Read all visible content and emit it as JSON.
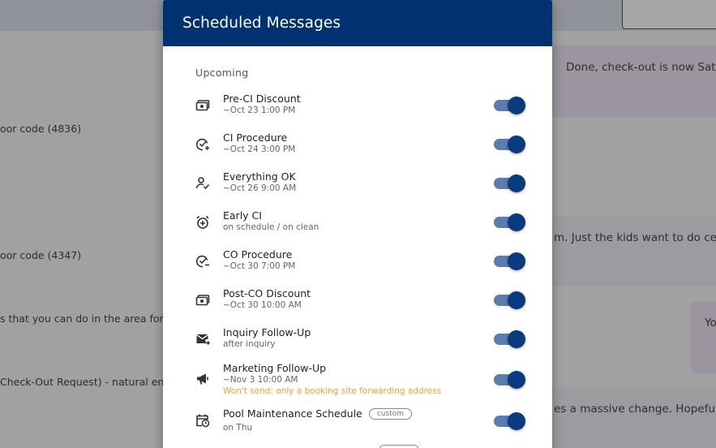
{
  "background": {
    "lines": [
      "oor code (4836)",
      "oor code (4347)",
      "s that you can do in the area for",
      "Check-Out Request) - natural en"
    ],
    "bubbles": [
      "Done, check-out is now Sat",
      "m. Just the kids want to do ce",
      "Yo",
      "es a massive change. Hopefull"
    ]
  },
  "modal": {
    "title": "Scheduled Messages",
    "section_label": "Upcoming",
    "items": [
      {
        "title": "Pre-CI Discount",
        "subtitle": "~Oct 23 1:00 PM",
        "icon": "discount-cash-icon",
        "enabled": true
      },
      {
        "title": "CI Procedure",
        "subtitle": "~Oct 24 3:00 PM",
        "icon": "check-circle-plus-icon",
        "enabled": true
      },
      {
        "title": "Everything OK",
        "subtitle": "~Oct 26 9:00 AM",
        "icon": "person-check-icon",
        "enabled": true
      },
      {
        "title": "Early CI",
        "subtitle": "on schedule / on clean",
        "icon": "alarm-clock-icon",
        "enabled": true
      },
      {
        "title": "CO Procedure",
        "subtitle": "~Oct 30 7:00 PM",
        "icon": "check-circle-minus-icon",
        "enabled": true
      },
      {
        "title": "Post-CO Discount",
        "subtitle": "~Oct 30 10:00 AM",
        "icon": "discount-cash-icon",
        "enabled": true
      },
      {
        "title": "Inquiry Follow-Up",
        "subtitle": "after inquiry",
        "icon": "mail-arrow-icon",
        "enabled": true
      },
      {
        "title": "Marketing Follow-Up",
        "subtitle": "~Nov 3 10:00 AM",
        "warning": "Won't send: only a booking site forwarding address",
        "icon": "megaphone-icon",
        "enabled": true
      },
      {
        "title": "Pool Maintenance Schedule",
        "badge": "custom",
        "subtitle": "on Thu",
        "icon": "calendar-clock-icon",
        "enabled": true
      }
    ]
  },
  "colors": {
    "header": "#003272",
    "toggle_track": "#5a7dad",
    "toggle_knob": "#0a3a80",
    "warning": "#f0a030"
  }
}
